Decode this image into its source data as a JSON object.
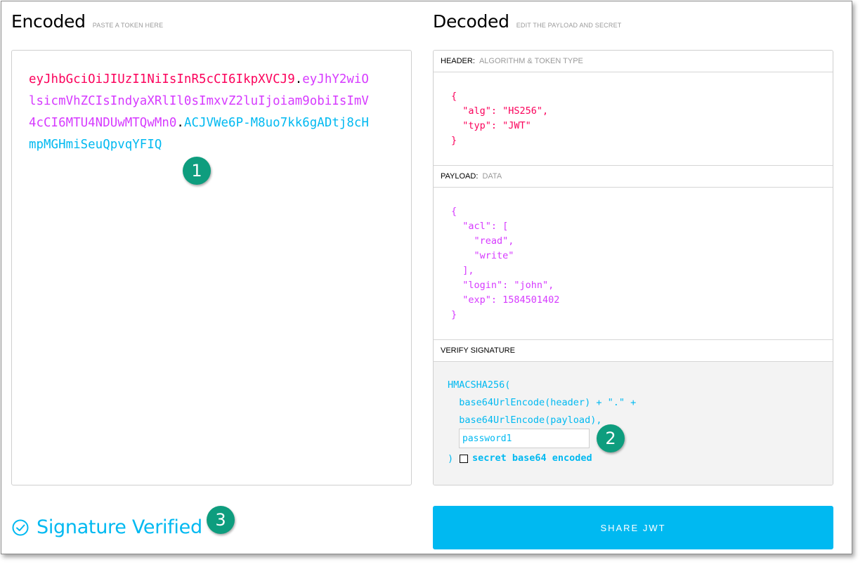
{
  "encoded": {
    "title": "Encoded",
    "hint": "PASTE A TOKEN HERE",
    "token_header": "eyJhbGciOiJIUzI1NiIsInR5cCI6IkpXVCJ9",
    "token_dot1": ".",
    "token_payload": "eyJhY2wiOlsicmVhZCIsIndyaXRlIl0sImxvZ2luIjoiam9obiIsImV4cCI6MTU4NDUwMTQwMn0",
    "token_dot2": ".",
    "token_signature": "ACJVWe6P-M8uo7kk6gADtj8cHmpMGHmiSeuQpvqYFIQ"
  },
  "decoded": {
    "title": "Decoded",
    "hint": "EDIT THE PAYLOAD AND SECRET",
    "header_label": "HEADER:",
    "header_sub": "ALGORITHM & TOKEN TYPE",
    "header_json": "{\n  \"alg\": \"HS256\",\n  \"typ\": \"JWT\"\n}",
    "payload_label": "PAYLOAD:",
    "payload_sub": "DATA",
    "payload_json": "{\n  \"acl\": [\n    \"read\",\n    \"write\"\n  ],\n  \"login\": \"john\",\n  \"exp\": 1584501402\n}",
    "verify_label": "VERIFY SIGNATURE",
    "verify_line1": "HMACSHA256(",
    "verify_line2": "  base64UrlEncode(header) + \".\" +",
    "verify_line3": "  base64UrlEncode(payload),",
    "secret_value": "password1",
    "verify_close": ")",
    "base64_label": "secret base64 encoded"
  },
  "status": {
    "text": "Signature Verified"
  },
  "share_button": "SHARE JWT",
  "callouts": [
    "1",
    "2",
    "3"
  ],
  "colors": {
    "header": "#fb015b",
    "payload": "#d63aff",
    "signature": "#00b9f1",
    "badge": "#0e9d7e"
  }
}
